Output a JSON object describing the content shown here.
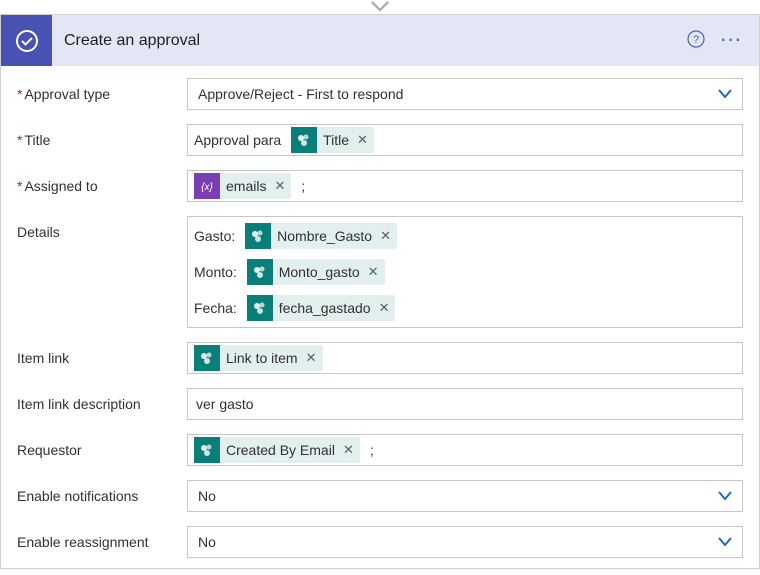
{
  "header": {
    "title": "Create an approval"
  },
  "fields": {
    "approval_type": {
      "label": "Approval type",
      "value": "Approve/Reject - First to respond"
    },
    "title": {
      "label": "Title",
      "prefix": "Approval para ",
      "token": "Title"
    },
    "assigned_to": {
      "label": "Assigned to",
      "token": "emails",
      "suffix": ";"
    },
    "details": {
      "label": "Details",
      "lines": [
        {
          "prefix": "Gasto: ",
          "token": "Nombre_Gasto"
        },
        {
          "prefix": "Monto: ",
          "token": "Monto_gasto"
        },
        {
          "prefix": "Fecha: ",
          "token": "fecha_gastado"
        }
      ]
    },
    "item_link": {
      "label": "Item link",
      "token": "Link to item"
    },
    "item_link_desc": {
      "label": "Item link description",
      "value": "ver gasto"
    },
    "requestor": {
      "label": "Requestor",
      "token": "Created By Email",
      "suffix": ";"
    },
    "enable_notifications": {
      "label": "Enable notifications",
      "value": "No"
    },
    "enable_reassignment": {
      "label": "Enable reassignment",
      "value": "No"
    }
  }
}
